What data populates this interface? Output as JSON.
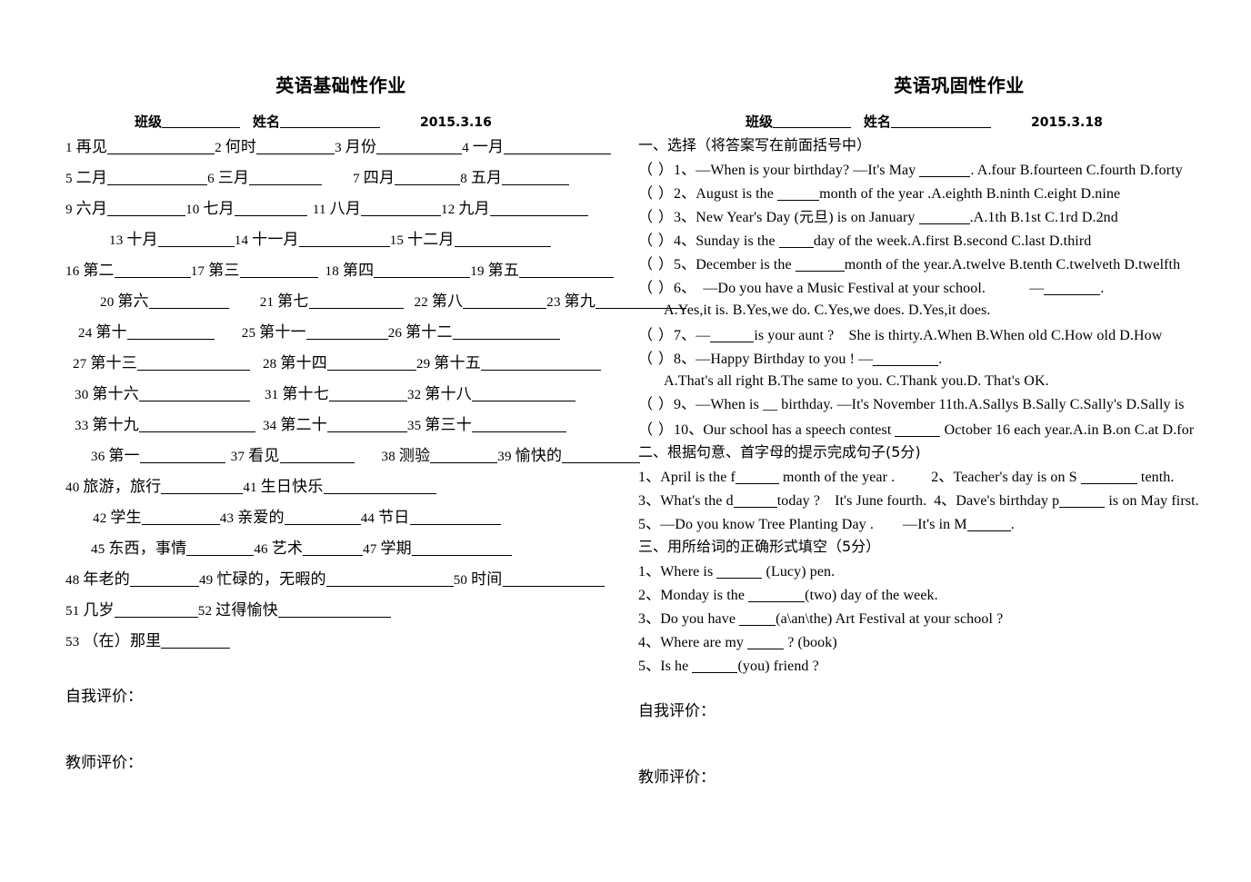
{
  "left_sheet": {
    "title": "英语基础性作业",
    "meta": {
      "class_label": "班级",
      "name_label": "姓名",
      "date": "2015.3.16"
    },
    "vocab_rows": [
      [
        {
          "num": "1",
          "text": "再见",
          "blank": 118
        },
        {
          "num": "2",
          "text": "何时",
          "blank": 86
        },
        {
          "num": "3",
          "text": "月份",
          "blank": 94
        },
        {
          "num": "4",
          "text": "一月",
          "blank": 118
        }
      ],
      [
        {
          "num": "5",
          "text": "二月",
          "blank": 110
        },
        {
          "num": "6",
          "text": "三月",
          "blank": 80
        },
        {
          "num": "7",
          "text": "四月",
          "blank": 72,
          "pad": 34
        },
        {
          "num": "8",
          "text": "五月",
          "blank": 74
        }
      ],
      [
        {
          "num": "9",
          "text": "六月",
          "blank": 86
        },
        {
          "num": "10",
          "text": "七月",
          "blank": 80
        },
        {
          "num": "11",
          "text": "八月",
          "blank": 88,
          "pad": 6
        },
        {
          "num": "12",
          "text": "九月",
          "blank": 108
        }
      ],
      [
        {
          "num": "13",
          "text": "十月",
          "blank": 84,
          "pad": 48
        },
        {
          "num": "14",
          "text": "十一月",
          "blank": 100
        },
        {
          "num": "15",
          "text": "十二月",
          "blank": 106
        }
      ],
      [
        {
          "num": "16",
          "text": "第二",
          "blank": 84
        },
        {
          "num": "17",
          "text": "第三",
          "blank": 86
        },
        {
          "num": "18",
          "text": "第四",
          "blank": 106,
          "pad": 8
        },
        {
          "num": "19",
          "text": "第五",
          "blank": 104
        }
      ],
      [
        {
          "num": "20",
          "text": "第六",
          "blank": 88,
          "pad": 38
        },
        {
          "num": "21",
          "text": "第七",
          "blank": 104,
          "pad": 34
        },
        {
          "num": "22",
          "text": "第八",
          "blank": 92,
          "pad": 12
        },
        {
          "num": "23",
          "text": "第九",
          "blank": 100
        }
      ],
      [
        {
          "num": "24",
          "text": "第十",
          "blank": 96,
          "pad": 14
        },
        {
          "num": "25",
          "text": "第十一",
          "blank": 90,
          "pad": 30
        },
        {
          "num": "26",
          "text": "第十二",
          "blank": 118
        }
      ],
      [
        {
          "num": "27",
          "text": "第十三",
          "blank": 124,
          "pad": 8
        },
        {
          "num": "28",
          "text": "第十四",
          "blank": 98,
          "pad": 14
        },
        {
          "num": "29",
          "text": "第十五",
          "blank": 132
        }
      ],
      [
        {
          "num": "30",
          "text": "第十六",
          "blank": 122,
          "pad": 10
        },
        {
          "num": "31",
          "text": "第十七",
          "blank": 86,
          "pad": 16
        },
        {
          "num": "32",
          "text": "第十八",
          "blank": 114
        }
      ],
      [
        {
          "num": "33",
          "text": "第十九",
          "blank": 128,
          "pad": 10
        },
        {
          "num": "34",
          "text": "第二十",
          "blank": 88,
          "pad": 8
        },
        {
          "num": "35",
          "text": "第三十",
          "blank": 104
        }
      ],
      [
        {
          "num": "36",
          "text": "第一",
          "blank": 94,
          "pad": 28
        },
        {
          "num": "37",
          "text": "看见",
          "blank": 82,
          "pad": 6
        },
        {
          "num": "38",
          "text": "测验",
          "blank": 74,
          "pad": 30
        },
        {
          "num": "39",
          "text": "愉快的",
          "blank": 86
        }
      ],
      [
        {
          "num": "40",
          "text": "旅游，旅行",
          "blank": 90
        },
        {
          "num": "41",
          "text": "生日快乐",
          "blank": 124
        }
      ],
      [
        {
          "num": "42",
          "text": "学生",
          "blank": 86,
          "pad": 30
        },
        {
          "num": "43",
          "text": "亲爱的",
          "blank": 84
        },
        {
          "num": "44",
          "text": "节日",
          "blank": 100
        }
      ],
      [
        {
          "num": "45",
          "text": "东西，事情",
          "blank": 74,
          "pad": 28
        },
        {
          "num": "46",
          "text": "艺术",
          "blank": 66
        },
        {
          "num": "47",
          "text": "学期",
          "blank": 110
        }
      ],
      [
        {
          "num": "48",
          "text": "年老的",
          "blank": 76
        },
        {
          "num": "49",
          "text": "忙碌的，无暇的",
          "blank": 140
        },
        {
          "num": "50",
          "text": "时间",
          "blank": 112
        }
      ],
      [
        {
          "num": "51",
          "text": "几岁",
          "blank": 92
        },
        {
          "num": "52",
          "text": "过得愉快",
          "blank": 124
        }
      ],
      [
        {
          "num": "53",
          "text": "（在）那里",
          "blank": 76
        }
      ]
    ],
    "self_eval": "自我评价：",
    "teacher_eval": "教师评价："
  },
  "right_sheet": {
    "title": "英语巩固性作业",
    "meta": {
      "class_label": "班级",
      "name_label": "姓名",
      "date": "2015.3.18"
    },
    "section1": {
      "heading": "一、选择（将答案写在前面括号中）",
      "items": [
        {
          "paren": "（ ）",
          "num": "1、",
          "pre": "—When is your birthday? —It's May ",
          "blank": 56,
          "post": ". A.four B.fourteen C.fourth D.forty"
        },
        {
          "paren": "（ ）",
          "num": "2、",
          "pre": "August is the ",
          "blank": 46,
          "post": "month of the year .A.eighth B.ninth C.eight D.nine"
        },
        {
          "paren": "（ ）",
          "num": "3、",
          "pre": "New Year's Day (元旦) is on January ",
          "blank": 56,
          "post": ".A.1th B.1st C.1rd D.2nd"
        },
        {
          "paren": "（ ）",
          "num": "4、",
          "pre": "Sunday is the ",
          "blank": 38,
          "post": "day of the week.A.first B.second C.last D.third"
        },
        {
          "paren": "（ ）",
          "num": "5、",
          "pre": "December is the ",
          "blank": 54,
          "post": "month of the year.A.twelve B.tenth C.twelveth D.twelfth"
        },
        {
          "paren": "（ ）",
          "num": "6、",
          "pre": "　—Do you have a Music Festival at your school.　　　—",
          "blank": 62,
          "post": "."
        },
        {
          "paren": "",
          "num": "",
          "pre": "A.Yes,it is. B.Yes,we do. C.Yes,we does. D.Yes,it does.",
          "blank": 0,
          "post": "",
          "indent": true
        },
        {
          "paren": "（ ）",
          "num": "7、",
          "pre": "—",
          "blank": 48,
          "post": "is your aunt ?　She is thirty.A.When B.When old C.How old D.How"
        },
        {
          "paren": "（ ）",
          "num": "8、",
          "pre": "—Happy Birthday to you !  —",
          "blank": 72,
          "post": "."
        },
        {
          "paren": "",
          "num": "",
          "pre": "A.That's all right B.The same to you. C.Thank you.D. That's OK.",
          "blank": 0,
          "post": "",
          "indent": true
        },
        {
          "paren": "（ ）",
          "num": "9、",
          "pre": "—When is __ birthday. —It's November 11th.A.Sallys B.Sally C.Sally's D.Sally is",
          "blank": 0,
          "post": ""
        },
        {
          "paren": "（ ）",
          "num": "10、",
          "pre": "Our school has a speech contest ",
          "blank": 50,
          "post": " October 16 each year.A.in B.on C.at D.for"
        }
      ]
    },
    "section2": {
      "heading": "二、根据句意、首字母的提示完成句子(5分)",
      "items": [
        {
          "segments": [
            {
              "num": "1、",
              "pre": "April is the f",
              "blank": 48,
              "post": " month of the year ."
            },
            {
              "num": "2、",
              "pre": "Teacher's day is on S ",
              "blank": 62,
              "post": " tenth.",
              "gap": 40
            }
          ]
        },
        {
          "segments": [
            {
              "num": "3、",
              "pre": "What's the d",
              "blank": 48,
              "post": "today ?　It's June fourth."
            },
            {
              "num": "4、",
              "pre": "Dave's birthday p",
              "blank": 50,
              "post": " is on May first.",
              "gap": 8
            }
          ]
        },
        {
          "segments": [
            {
              "num": "5、",
              "pre": "—Do you know Tree Planting Day .　　—It's in M",
              "blank": 48,
              "post": "."
            }
          ]
        }
      ]
    },
    "section3": {
      "heading": "三、用所给词的正确形式填空（5分）",
      "items": [
        {
          "num": "1、",
          "pre": "Where is ",
          "blank": 50,
          "post": " (Lucy) pen."
        },
        {
          "num": "2、",
          "pre": "Monday is the ",
          "blank": 62,
          "post": "(two) day of the week."
        },
        {
          "num": "3、",
          "pre": "Do you have ",
          "blank": 40,
          "post": "(a\\an\\the) Art Festival at your school ?"
        },
        {
          "num": "4、",
          "pre": "Where are my ",
          "blank": 40,
          "post": " ? (book)"
        },
        {
          "num": "5、",
          "pre": "Is he ",
          "blank": 50,
          "post": "(you) friend ?"
        }
      ]
    },
    "self_eval": "自我评价：",
    "teacher_eval": "教师评价："
  }
}
